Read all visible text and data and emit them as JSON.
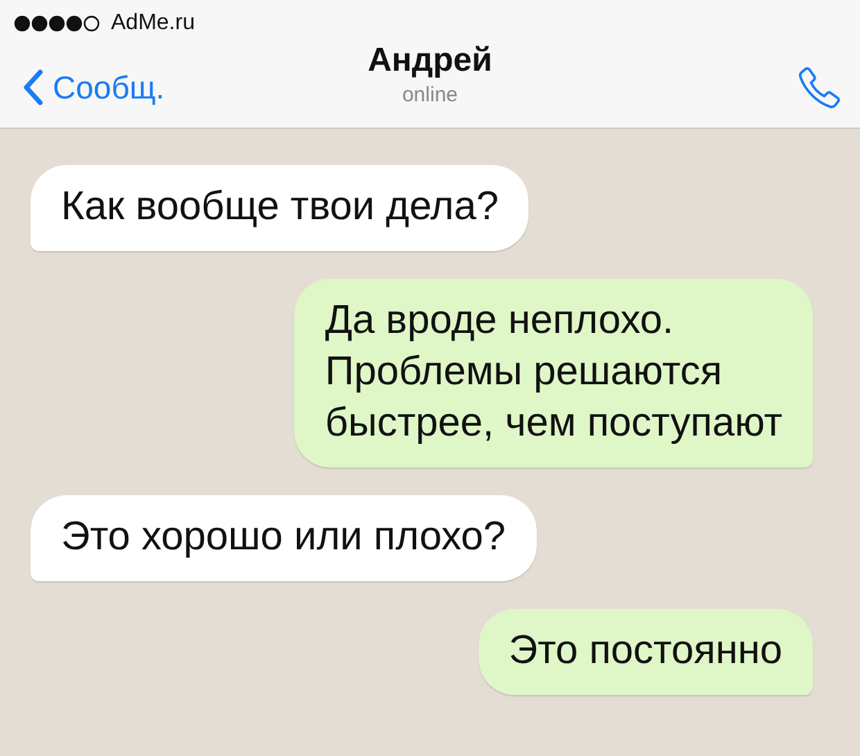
{
  "status_bar": {
    "carrier": "AdMe.ru"
  },
  "header": {
    "back_label": "Сообщ.",
    "contact_name": "Андрей",
    "contact_status": "online"
  },
  "messages": [
    {
      "kind": "incoming",
      "text": "Как вообще твои дела?"
    },
    {
      "kind": "outgoing",
      "text": "Да вроде неплохо.\nПроблемы решаются\nбыстрее, чем поступают"
    },
    {
      "kind": "incoming",
      "text": "Это хорошо или плохо?"
    },
    {
      "kind": "outgoing",
      "text": "Это постоянно"
    }
  ]
}
